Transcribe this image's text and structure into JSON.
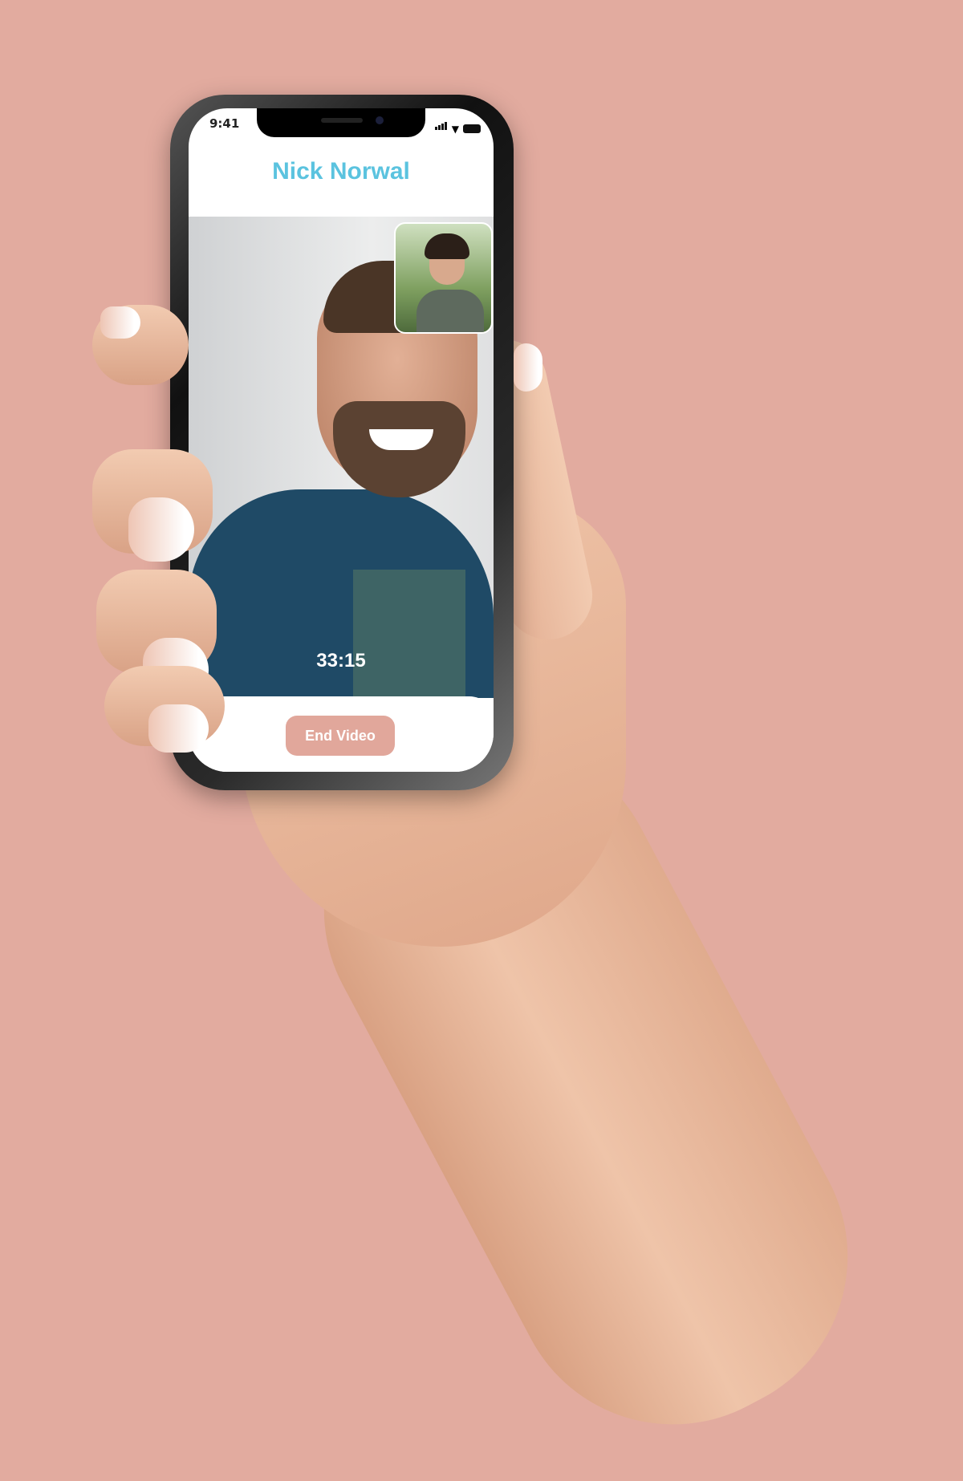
{
  "status_bar": {
    "time": "9:41",
    "icons": [
      "signal-icon",
      "wifi-icon",
      "battery-icon"
    ]
  },
  "call": {
    "contact_name": "Nick Norwal",
    "duration": "33:15",
    "end_button_label": "End Video"
  },
  "colors": {
    "background": "#e2ab9f",
    "title": "#5bc3df",
    "end_button": "#e1a79b"
  }
}
